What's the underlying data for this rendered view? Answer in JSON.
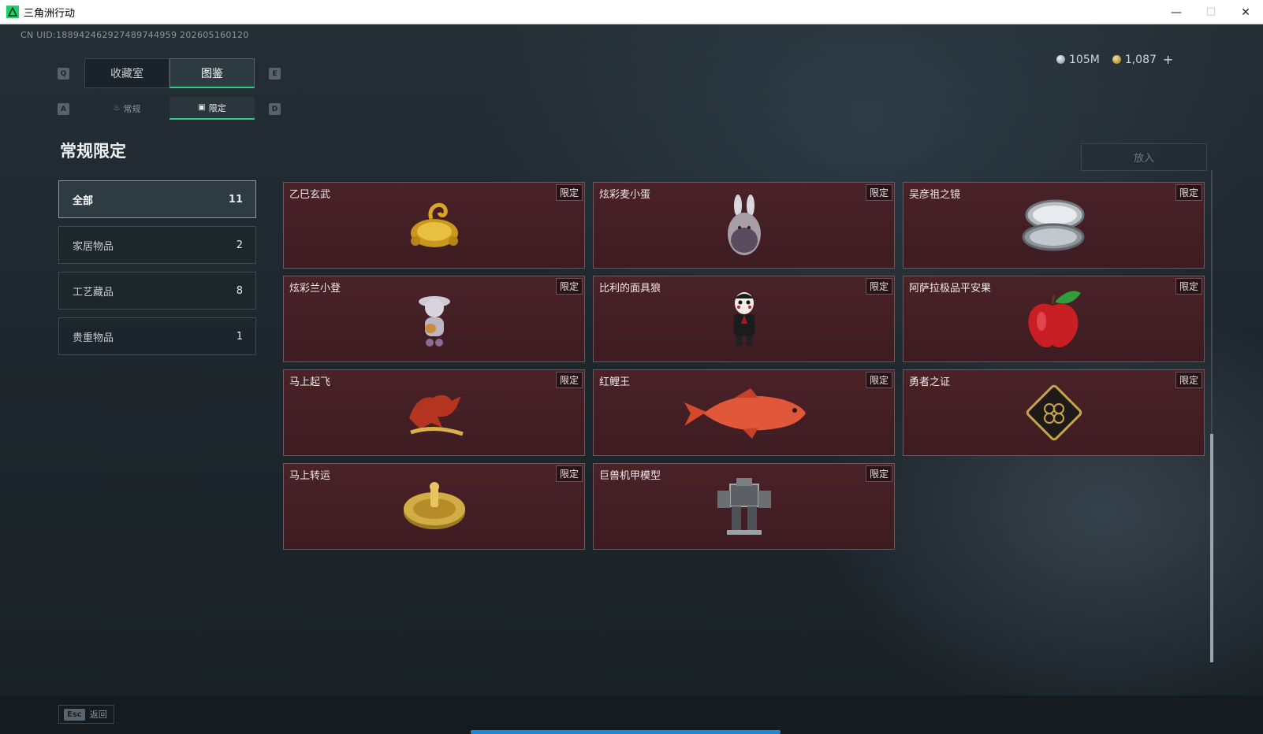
{
  "window": {
    "title": "三角洲行动",
    "minimize": "—",
    "maximize": "☐",
    "close": "✕"
  },
  "uid": "CN UID:18894246292748974495​9 202605160120",
  "currency": {
    "silver": "105M",
    "gold": "1,087",
    "plus": "+"
  },
  "hotkeys": {
    "prev_tab": "Q",
    "next_tab": "E",
    "prev_sub": "A",
    "next_sub": "D"
  },
  "tabs": [
    {
      "label": "收藏室"
    },
    {
      "label": "图鉴"
    }
  ],
  "subtabs": [
    {
      "label": "常规",
      "icon": "flame-icon"
    },
    {
      "label": "限定",
      "icon": "image-icon"
    }
  ],
  "section_title": "常规限定",
  "import_label": "放入",
  "categories": [
    {
      "label": "全部",
      "count": "11"
    },
    {
      "label": "家居物品",
      "count": "2"
    },
    {
      "label": "工艺藏品",
      "count": "8"
    },
    {
      "label": "贵重物品",
      "count": "1"
    }
  ],
  "items": [
    {
      "name": "乙巳玄武",
      "badge": "限定",
      "icon": "golden-dragon-turtle-icon"
    },
    {
      "name": "炫彩麦小蛋",
      "badge": "限定",
      "icon": "bunny-egg-icon"
    },
    {
      "name": "吴彦祖之镜",
      "badge": "限定",
      "icon": "compact-mirror-icon"
    },
    {
      "name": "炫彩兰小登",
      "badge": "限定",
      "icon": "guitar-figure-icon"
    },
    {
      "name": "比利的面具狼",
      "badge": "限定",
      "icon": "puppet-doll-icon"
    },
    {
      "name": "阿萨拉极品平安果",
      "badge": "限定",
      "icon": "red-apple-icon"
    },
    {
      "name": "马上起飞",
      "badge": "限定",
      "icon": "red-horse-icon"
    },
    {
      "name": "红鲤王",
      "badge": "限定",
      "icon": "red-carp-icon"
    },
    {
      "name": "勇者之证",
      "badge": "限定",
      "icon": "medal-card-icon"
    },
    {
      "name": "马上转运",
      "badge": "限定",
      "icon": "golden-wheel-icon"
    },
    {
      "name": "巨兽机甲模型",
      "badge": "限定",
      "icon": "mech-model-icon"
    }
  ],
  "footer": {
    "esc_key": "Esc",
    "esc_label": "返回"
  }
}
